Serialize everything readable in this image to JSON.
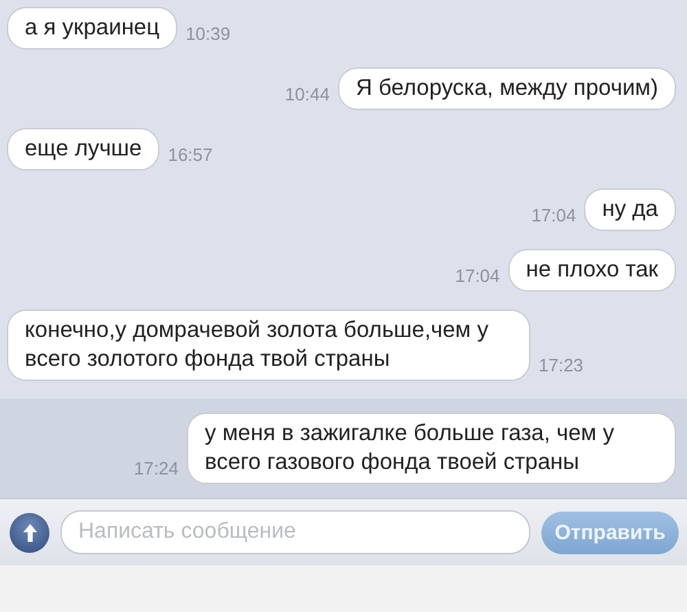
{
  "messages": [
    {
      "kind": "incoming",
      "text": "а я украинец",
      "time": "10:39",
      "highlighted": false
    },
    {
      "kind": "outgoing",
      "text": "Я белоруска, между прочим)",
      "time": "10:44",
      "highlighted": false
    },
    {
      "kind": "incoming",
      "text": "еще лучше",
      "time": "16:57",
      "highlighted": false
    },
    {
      "kind": "outgoing",
      "text": "ну да",
      "time": "17:04",
      "highlighted": false
    },
    {
      "kind": "outgoing",
      "text": "не плохо так",
      "time": "17:04",
      "highlighted": false
    },
    {
      "kind": "incoming",
      "text": "конечно,у домрачевой золота больше,чем у всего золотого фонда твой страны",
      "time": "17:23",
      "highlighted": false
    },
    {
      "kind": "outgoing",
      "text": "у меня в зажигалке больше газа, чем у всего газового фонда твоей страны",
      "time": "17:24",
      "highlighted": true
    }
  ],
  "composer": {
    "placeholder": "Написать сообщение",
    "send_button": "Отправить"
  }
}
